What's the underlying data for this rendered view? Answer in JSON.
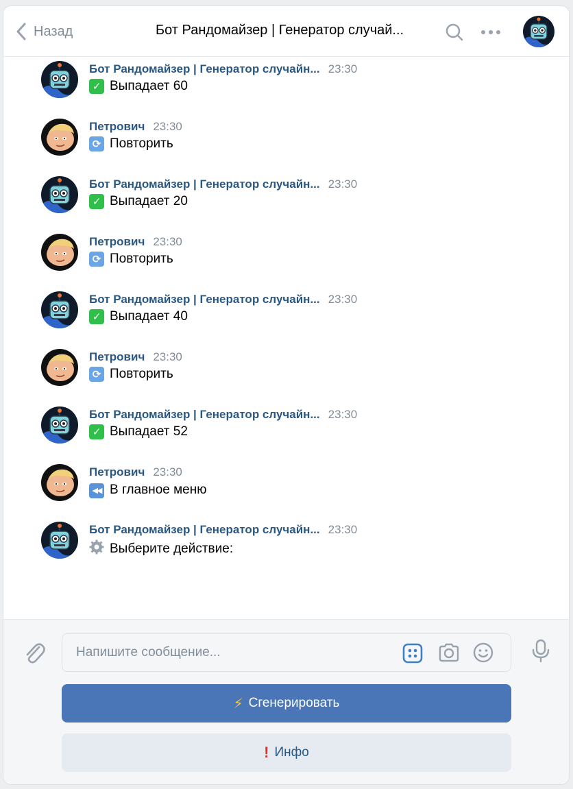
{
  "header": {
    "back_label": "Назад",
    "title": "Бот Рандомайзер | Генератор случай..."
  },
  "messages": [
    {
      "author": "Бот Рандомайзер | Генератор случайн...",
      "time": "23:30",
      "icon": "check-mark-icon",
      "text": "Выпадает 60"
    },
    {
      "author": "Петрович",
      "time": "23:30",
      "icon": "repeat-icon",
      "text": "Повторить"
    },
    {
      "author": "Бот Рандомайзер | Генератор случайн...",
      "time": "23:30",
      "icon": "check-mark-icon",
      "text": "Выпадает 20"
    },
    {
      "author": "Петрович",
      "time": "23:30",
      "icon": "repeat-icon",
      "text": "Повторить"
    },
    {
      "author": "Бот Рандомайзер | Генератор случайн...",
      "time": "23:30",
      "icon": "check-mark-icon",
      "text": "Выпадает 40"
    },
    {
      "author": "Петрович",
      "time": "23:30",
      "icon": "repeat-icon",
      "text": "Повторить"
    },
    {
      "author": "Бот Рандомайзер | Генератор случайн...",
      "time": "23:30",
      "icon": "check-mark-icon",
      "text": "Выпадает 52"
    },
    {
      "author": "Петрович",
      "time": "23:30",
      "icon": "rewind-icon",
      "text": "В главное меню"
    },
    {
      "author": "Бот Рандомайзер | Генератор случайн...",
      "time": "23:30",
      "icon": "gear-icon",
      "text": "Выберите действие:"
    }
  ],
  "composer": {
    "placeholder": "Напишите сообщение...",
    "value": ""
  },
  "keyboard": {
    "generate_label": "Сгенерировать",
    "generate_icon": "lightning-icon",
    "info_label": "Инфо",
    "info_icon": "exclamation-icon"
  },
  "colors": {
    "link": "#2a5885",
    "primary_button": "#4a76b8",
    "secondary_button": "#e5ebf1",
    "muted": "#818c99"
  }
}
